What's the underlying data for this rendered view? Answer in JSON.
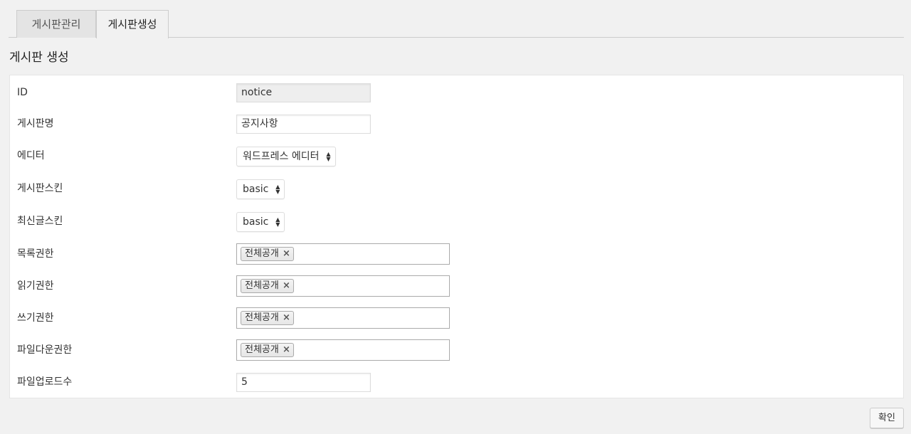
{
  "tabs": [
    {
      "label": "게시판관리"
    },
    {
      "label": "게시판생성"
    }
  ],
  "page_title": "게시판 생성",
  "form": {
    "id": {
      "label": "ID",
      "value": "notice"
    },
    "name": {
      "label": "게시판명",
      "value": "공지사항"
    },
    "editor": {
      "label": "에디터",
      "value": "워드프레스 에디터"
    },
    "board_skin": {
      "label": "게시판스킨",
      "value": "basic"
    },
    "latest_skin": {
      "label": "최신글스킨",
      "value": "basic"
    },
    "list_perm": {
      "label": "목록권한",
      "tag": "전체공개"
    },
    "read_perm": {
      "label": "읽기권한",
      "tag": "전체공개"
    },
    "write_perm": {
      "label": "쓰기권한",
      "tag": "전체공개"
    },
    "download_perm": {
      "label": "파일다운권한",
      "tag": "전체공개"
    },
    "upload_count": {
      "label": "파일업로드수",
      "value": "5"
    }
  },
  "ok_label": "확인",
  "icons": {
    "select_arrows": "sort-arrows-icon",
    "chip_remove": "close-icon"
  }
}
